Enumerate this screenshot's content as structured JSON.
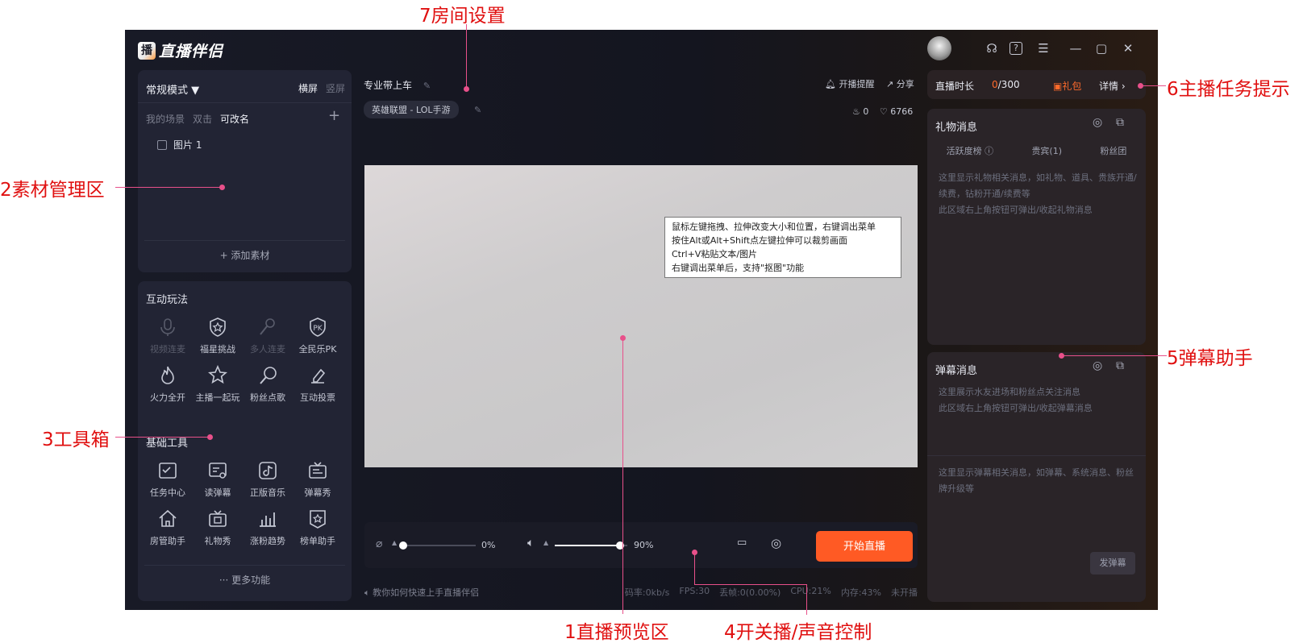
{
  "app": {
    "name": "直播伴侣",
    "logo_glyph": "播"
  },
  "titlebar": {
    "icons": [
      "headset-icon",
      "help-icon",
      "menu-icon",
      "minimize-icon",
      "maximize-icon",
      "close-icon"
    ],
    "glyphs": [
      "☊",
      "?",
      "☰",
      "—",
      "▢",
      "✕"
    ]
  },
  "scene_panel": {
    "mode": "常规模式 ▼",
    "orient_h": "横屏",
    "orient_v": "竖屏",
    "tabs": [
      "我的场景",
      "双击",
      "可改名"
    ],
    "add": "+",
    "sources": [
      {
        "label": "图片 1"
      }
    ],
    "add_source": "+ 添加素材"
  },
  "tools_panel": {
    "interactive_title": "互动玩法",
    "interactive": [
      {
        "label": "视频连麦",
        "disabled": true
      },
      {
        "label": "福星挑战",
        "disabled": false
      },
      {
        "label": "多人连麦",
        "disabled": true
      },
      {
        "label": "全民乐PK",
        "disabled": false
      },
      {
        "label": "火力全开",
        "disabled": false
      },
      {
        "label": "主播一起玩",
        "disabled": false
      },
      {
        "label": "粉丝点歌",
        "disabled": false
      },
      {
        "label": "互动投票",
        "disabled": false
      }
    ],
    "basic_title": "基础工具",
    "basic": [
      {
        "label": "任务中心"
      },
      {
        "label": "读弹幕"
      },
      {
        "label": "正版音乐"
      },
      {
        "label": "弹幕秀"
      },
      {
        "label": "房管助手"
      },
      {
        "label": "礼物秀"
      },
      {
        "label": "涨粉趋势"
      },
      {
        "label": "榜单助手"
      }
    ],
    "more": "··· 更多功能"
  },
  "room": {
    "title": "专业带上车",
    "category": "英雄联盟 - LOL手游",
    "remind": "开播提醒",
    "share": "分享",
    "hot": "0",
    "likes": "6766"
  },
  "preview": {
    "tooltip": [
      "鼠标左键拖拽、拉伸改变大小和位置，右键调出菜单",
      "按住Alt或Alt+Shift点左键拉伸可以裁剪画面",
      "Ctrl+V粘贴文本/图片",
      "右键调出菜单后，支持\"抠图\"功能"
    ]
  },
  "audio": {
    "mic_level": 0,
    "mic_pct": "0%",
    "speaker_level": 0.9,
    "speaker_pct": "90%",
    "start_label": "开始直播"
  },
  "status": {
    "help": "教你如何快速上手直播伴侣",
    "metrics": [
      "码率:0kb/s",
      "FPS:30",
      "丢帧:0(0.00%)",
      "CPU:21%",
      "内存:43%",
      "未开播"
    ]
  },
  "task": {
    "label": "直播时长",
    "current": "0",
    "total": "/300",
    "gift": "礼包",
    "detail": "详情 ›"
  },
  "gift_panel": {
    "title": "礼物消息",
    "tabs": [
      "活跃度榜 ⓘ",
      "贵宾(1)",
      "粉丝团"
    ],
    "message": "这里显示礼物相关消息，如礼物、道具、贵族开通/续费，钻粉开通/续费等\n此区域右上角按钮可弹出/收起礼物消息"
  },
  "danmu_panel": {
    "title": "弹幕消息",
    "message1": "这里展示水友进场和粉丝点关注消息\n此区域右上角按钮可弹出/收起弹幕消息",
    "message2": "这里显示弹幕相关消息，如弹幕、系统消息、粉丝牌升级等",
    "send": "发弹幕"
  },
  "callouts": {
    "c1": "1直播预览区",
    "c2": "2素材管理区",
    "c3": "3工具箱",
    "c4": "4开关播/声音控制",
    "c5": "5弹幕助手",
    "c6": "6主播任务提示",
    "c7": "7房间设置"
  },
  "colors": {
    "accent": "#ff5a24",
    "callout": "#e01010",
    "leader": "#e8508a"
  }
}
